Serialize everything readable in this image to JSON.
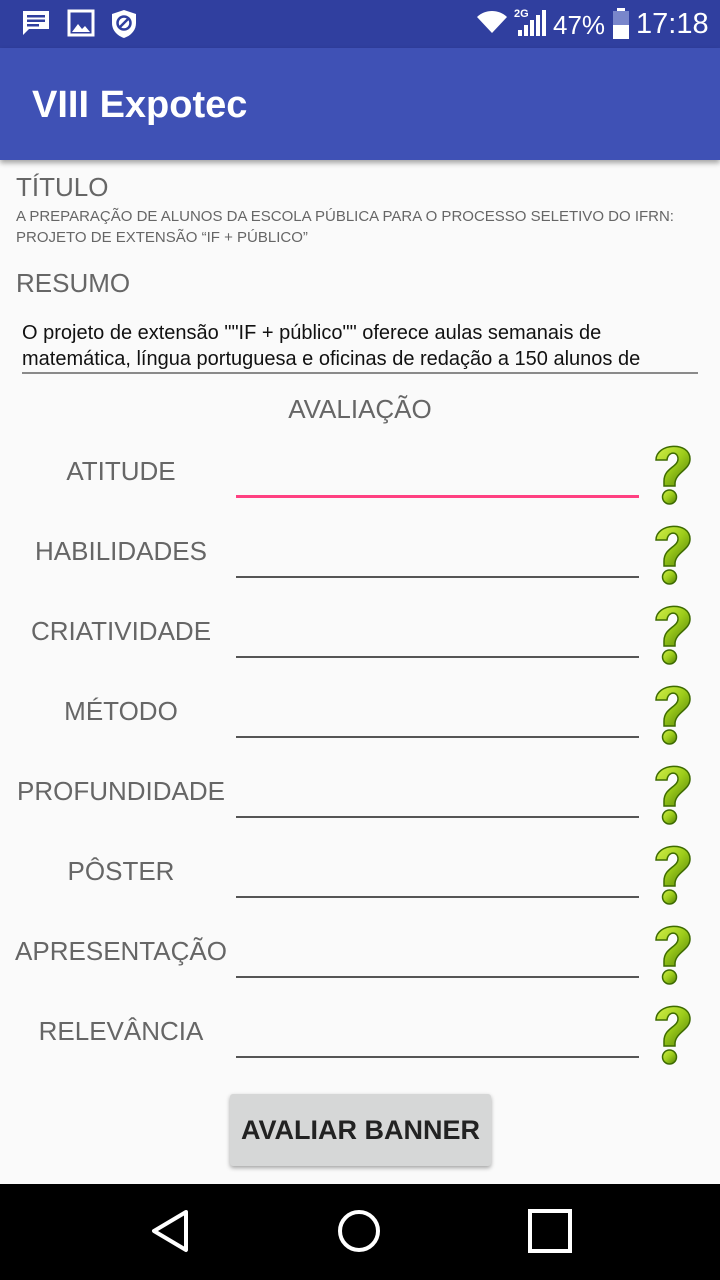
{
  "status_bar": {
    "battery": "47%",
    "time": "17:18",
    "network": "2G",
    "icons": [
      "message-icon",
      "image-icon",
      "block-icon",
      "wifi-icon",
      "signal-icon",
      "battery-icon"
    ]
  },
  "app_bar": {
    "title": "VIII Expotec"
  },
  "titulo": {
    "label": "TÍTULO",
    "text": "A PREPARAÇÃO DE ALUNOS DA ESCOLA PÚBLICA PARA O PROCESSO SELETIVO DO IFRN: PROJETO DE EXTENSÃO “IF + PÚBLICO”"
  },
  "resumo": {
    "label": "RESUMO",
    "text": "O projeto de extensão \"\"IF + público\"\" oferece aulas semanais de matemática, língua portuguesa e oficinas de redação a 150 alunos de"
  },
  "avaliacao": {
    "title": "AVALIAÇÃO",
    "criteria": [
      {
        "label": "ATITUDE",
        "value": ""
      },
      {
        "label": "HABILIDADES",
        "value": ""
      },
      {
        "label": "CRIATIVIDADE",
        "value": ""
      },
      {
        "label": "MÉTODO",
        "value": ""
      },
      {
        "label": "PROFUNDIDADE",
        "value": ""
      },
      {
        "label": "PÔSTER",
        "value": ""
      },
      {
        "label": "APRESENTAÇÃO",
        "value": ""
      },
      {
        "label": "RELEVÂNCIA",
        "value": ""
      }
    ]
  },
  "submit_button": {
    "label": "AVALIAR BANNER"
  },
  "colors": {
    "status_bar": "#303f9f",
    "app_bar": "#3f51b5",
    "focus_accent": "#ff4081",
    "help_icon": "#9ccc1a"
  },
  "nav_bar": {
    "icons": [
      "back-icon",
      "home-icon",
      "recents-icon"
    ]
  }
}
